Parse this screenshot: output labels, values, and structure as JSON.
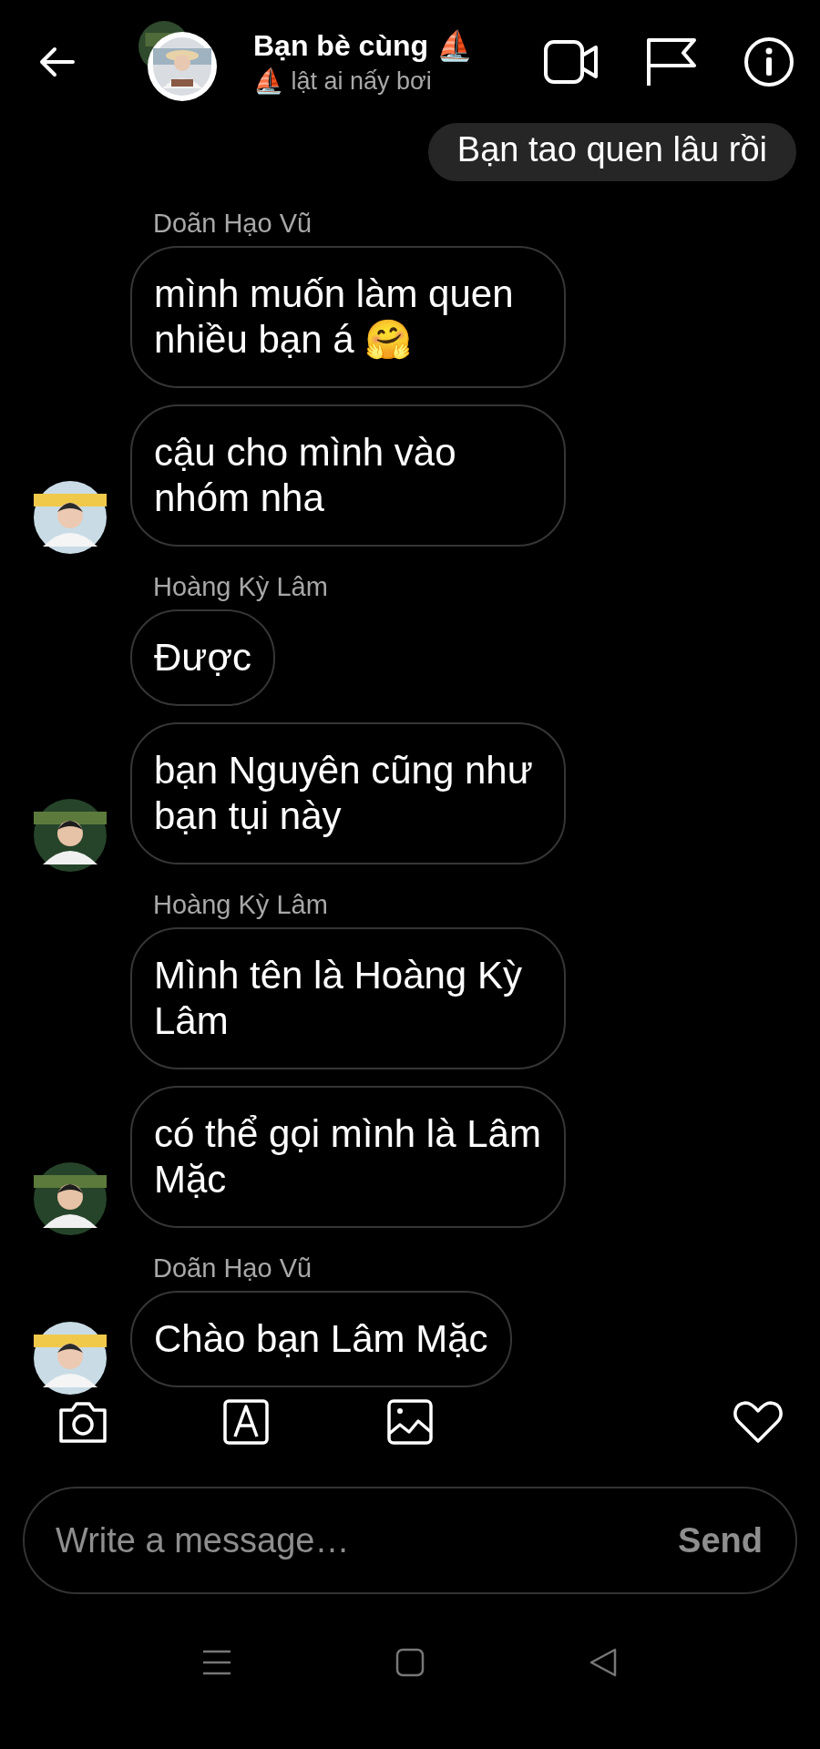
{
  "header": {
    "title": "Bạn bè cùng ⛵",
    "subtitle": "⛵ lật ai nấy bơi"
  },
  "previous_message": {
    "text": "Bạn tao quen lâu rồi"
  },
  "groups": [
    {
      "sender": "Doãn Hạo Vũ",
      "kind": "light",
      "messages": [
        "mình muốn làm quen nhiều bạn á 🤗",
        "cậu cho mình vào nhóm nha"
      ]
    },
    {
      "sender": "Hoàng Kỳ Lâm",
      "kind": "dark",
      "messages": [
        "Được",
        "bạn Nguyên cũng như bạn tụi này"
      ]
    },
    {
      "sender": "Hoàng Kỳ Lâm",
      "kind": "dark",
      "messages": [
        "Mình tên là Hoàng Kỳ Lâm",
        "có thể gọi mình là Lâm Mặc"
      ]
    },
    {
      "sender": "Doãn Hạo Vũ",
      "kind": "light",
      "messages": [
        "Chào bạn Lâm Mặc"
      ]
    }
  ],
  "composer": {
    "placeholder": "Write a message…",
    "send": "Send"
  }
}
